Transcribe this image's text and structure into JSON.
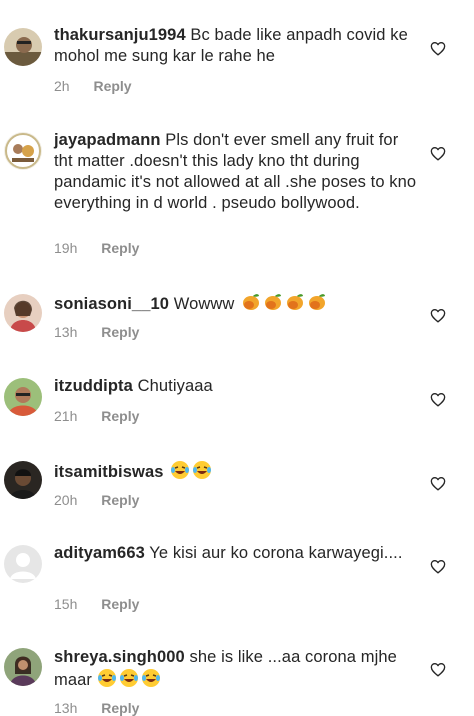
{
  "comments": [
    {
      "username": "thakursanju1994",
      "text": "Bc bade like anpadh covid ke mohol me sung kar le rahe he",
      "time": "2h",
      "reply_label": "Reply"
    },
    {
      "username": "jayapadmann",
      "text": "Pls don't ever smell any fruit for tht matter .doesn't this lady kno tht during pandamic it's not allowed at all .she poses to kno everything in d world . pseudo bollywood.",
      "time": "19h",
      "reply_label": "Reply"
    },
    {
      "username": "soniasoni__10",
      "text": "Wowww",
      "emoji": "mango-emoji",
      "emoji_count": 4,
      "time": "13h",
      "reply_label": "Reply"
    },
    {
      "username": "itzuddipta",
      "text": "Chutiyaaa",
      "time": "21h",
      "reply_label": "Reply"
    },
    {
      "username": "itsamitbiswas",
      "text": "",
      "emoji": "laughing-tears-emoji",
      "emoji_count": 2,
      "time": "20h",
      "reply_label": "Reply"
    },
    {
      "username": "adityam663",
      "text": "Ye kisi aur ko corona karwayegi....",
      "time": "15h",
      "reply_label": "Reply"
    },
    {
      "username": "shreya.singh000",
      "text": "she is like ...aa corona mjhe maar",
      "emoji": "laughing-tears-emoji",
      "emoji_count": 3,
      "time": "13h",
      "reply_label": "Reply"
    }
  ],
  "icons": {
    "like": "heart-outline-icon"
  },
  "colors": {
    "text": "#262626",
    "meta": "#8e8e8e",
    "background": "#ffffff"
  }
}
